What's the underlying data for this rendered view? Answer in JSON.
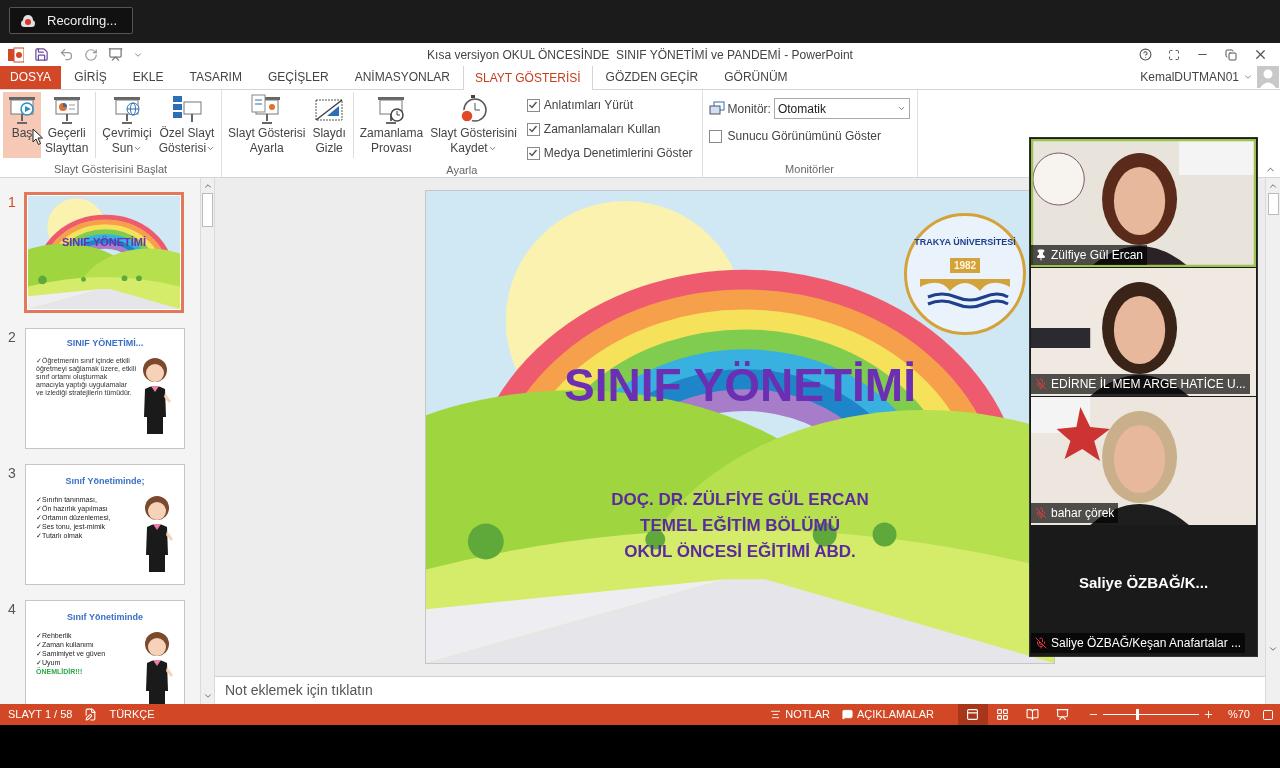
{
  "recording_indicator": {
    "label": "Recording..."
  },
  "window": {
    "title": "Kısa versiyon OKUL ÖNCESİNDE  SINIF YÖNETİMİ ve PANDEMİ - PowerPoint",
    "user": "KemalDUTMAN01"
  },
  "tabs": [
    {
      "label": "DOSYA",
      "kind": "file",
      "selected": false
    },
    {
      "label": "GİRİŞ",
      "kind": "tab",
      "selected": false
    },
    {
      "label": "EKLE",
      "kind": "tab",
      "selected": false
    },
    {
      "label": "TASARIM",
      "kind": "tab",
      "selected": false
    },
    {
      "label": "GEÇİŞLER",
      "kind": "tab",
      "selected": false
    },
    {
      "label": "ANİMASYONLAR",
      "kind": "tab",
      "selected": false
    },
    {
      "label": "SLAYT GÖSTERİSİ",
      "kind": "tab",
      "selected": true
    },
    {
      "label": "GÖZDEN GEÇİR",
      "kind": "tab",
      "selected": false
    },
    {
      "label": "GÖRÜNÜM",
      "kind": "tab",
      "selected": false
    }
  ],
  "ribbon": {
    "groups": [
      {
        "label": "Slayt Gösterisini Başlat",
        "buttons": [
          {
            "lines": [
              "Baş"
            ],
            "highlighted": true,
            "dropdown": false,
            "separator_before": false
          },
          {
            "lines": [
              "Geçerli",
              "Slayttan"
            ],
            "highlighted": false,
            "dropdown": false,
            "separator_before": false
          },
          {
            "lines": [
              "Çevrimiçi",
              "Sun"
            ],
            "highlighted": false,
            "dropdown": true,
            "separator_before": true
          },
          {
            "lines": [
              "Özel Slayt",
              "Gösterisi"
            ],
            "highlighted": false,
            "dropdown": true,
            "separator_before": false
          }
        ]
      },
      {
        "label": "Ayarla",
        "buttons": [
          {
            "lines": [
              "Slayt Gösterisi",
              "Ayarla"
            ],
            "highlighted": false,
            "dropdown": false,
            "separator_before": false
          },
          {
            "lines": [
              "Slaydı",
              "Gizle"
            ],
            "highlighted": false,
            "dropdown": false,
            "separator_before": false
          },
          {
            "lines": [
              "Zamanlama",
              "Provası"
            ],
            "highlighted": false,
            "dropdown": false,
            "separator_before": true
          },
          {
            "lines": [
              "Slayt Gösterisini",
              "Kaydet"
            ],
            "highlighted": false,
            "dropdown": true,
            "separator_before": false
          }
        ],
        "checkboxes": [
          {
            "label": "Anlatımları Yürüt",
            "checked": true
          },
          {
            "label": "Zamanlamaları Kullan",
            "checked": true
          },
          {
            "label": "Medya Denetimlerini Göster",
            "checked": true
          }
        ]
      }
    ],
    "monitors": {
      "label": "Monitörler",
      "monitor_label": "Monitör:",
      "monitor_value": "Otomatik",
      "presenter_view": {
        "label": "Sunucu Görünümünü Göster",
        "checked": false
      }
    }
  },
  "slides": [
    {
      "number": "1",
      "kind": "title",
      "selected": true,
      "title": "SINIF YÖNETİMİ"
    },
    {
      "number": "2",
      "kind": "text",
      "selected": false,
      "title": "SINIF YÖNETİMİ...",
      "body": "✓Öğretmenin sınıf içinde etkili öğretmeyi sağlamak üzere, etkili sınıf ortamı oluşturmak amacıyla yaptığı uygulamalar ve izlediği stratejilerin tümüdür."
    },
    {
      "number": "3",
      "kind": "bullets",
      "selected": false,
      "title": "Sınıf Yönetiminde;",
      "bullets": [
        "✓Sınıfın tanınması,",
        "✓Ön hazırlık yapılması",
        "✓Ortamın düzenlemesi,",
        "✓Ses tonu, jest-mimik",
        "✓Tutarlı olmak"
      ]
    },
    {
      "number": "4",
      "kind": "bullets",
      "selected": false,
      "title": "Sınıf Yönetiminde",
      "bullets": [
        "✓Rehberlik",
        "✓Zaman kullanımı",
        "✓Samimiyet ve güven",
        "✓Uyum"
      ],
      "emphasis": "ÖNEMLİDİR!!!"
    }
  ],
  "main_slide": {
    "title": "SINIF YÖNETİMİ",
    "subtitle_lines": [
      "DOÇ. DR. ZÜLFİYE GÜL ERCAN",
      "TEMEL EĞİTİM BÖLÜMÜ",
      "OKUL ÖNCESİ EĞİTİMİ ABD."
    ],
    "logo": {
      "name": "TRAKYA ÜNİVERSİTESİ",
      "year": "1982"
    }
  },
  "notes_placeholder": "Not eklemek için tıklatın",
  "video_panel": {
    "participants": [
      {
        "name": "Zülfiye Gül Ercan",
        "kind": "video",
        "pinned": true,
        "muted": false,
        "highlighted": true
      },
      {
        "name": "EDİRNE İL MEM ARGE HATİCE U...",
        "kind": "video",
        "pinned": false,
        "muted": true,
        "highlighted": false
      },
      {
        "name": "bahar çörek",
        "kind": "video",
        "pinned": false,
        "muted": true,
        "highlighted": false
      },
      {
        "name": "Saliye ÖZBAĞ/Keşan Anafartalar ...",
        "display_name": "Saliye ÖZBAĞ/K...",
        "kind": "no_video",
        "pinned": false,
        "muted": true,
        "highlighted": false
      }
    ]
  },
  "status_bar": {
    "slide": "SLAYT 1 / 58",
    "language": "TÜRKÇE",
    "notes": "NOTLAR",
    "comments": "AÇIKLAMALAR",
    "views": [
      {
        "kind": "normal",
        "selected": true
      },
      {
        "kind": "sorter",
        "selected": false
      },
      {
        "kind": "reading",
        "selected": false
      },
      {
        "kind": "slideshow",
        "selected": false
      }
    ],
    "zoom": {
      "level": 0.34,
      "reading": "%70"
    }
  }
}
